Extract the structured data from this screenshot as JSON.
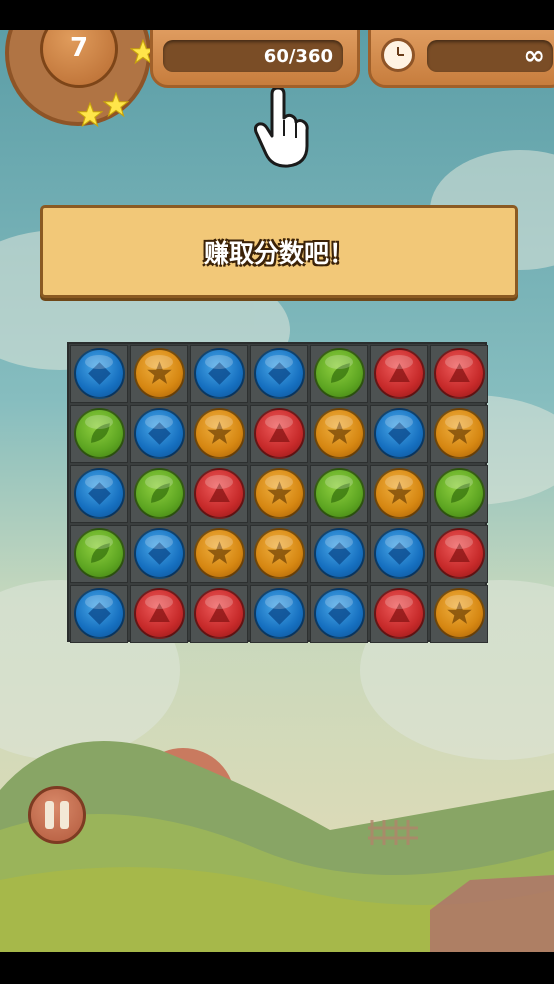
{
  "hud": {
    "level": "7",
    "score_text": "60/360",
    "time_text": "∞",
    "stars_earned": 3
  },
  "banner": {
    "text": "赚取分数吧！"
  },
  "board": {
    "rows": 5,
    "cols": 7,
    "grid": [
      [
        "blue-diamond",
        "orange-star",
        "blue-diamond",
        "blue-diamond",
        "green-leaf",
        "red-triangle",
        "red-triangle"
      ],
      [
        "green-leaf",
        "blue-diamond",
        "orange-star",
        "red-triangle",
        "orange-star",
        "blue-diamond",
        "orange-star"
      ],
      [
        "blue-diamond",
        "green-leaf",
        "red-triangle",
        "orange-star",
        "green-leaf",
        "orange-star",
        "green-leaf"
      ],
      [
        "green-leaf",
        "blue-diamond",
        "orange-star",
        "orange-star",
        "blue-diamond",
        "blue-diamond",
        "red-triangle"
      ],
      [
        "blue-diamond",
        "red-triangle",
        "red-triangle",
        "blue-diamond",
        "blue-diamond",
        "red-triangle",
        "orange-star"
      ]
    ]
  },
  "icons": {
    "clock": "clock-icon",
    "pointer": "hand-pointer-icon",
    "pause": "pause-icon",
    "star": "star-icon"
  },
  "colors": {
    "blue": "#1670c0",
    "orange": "#d68712",
    "green": "#5ea622",
    "red": "#c72a2a",
    "wood": "#c77d3d",
    "banner": "#f2c878"
  }
}
